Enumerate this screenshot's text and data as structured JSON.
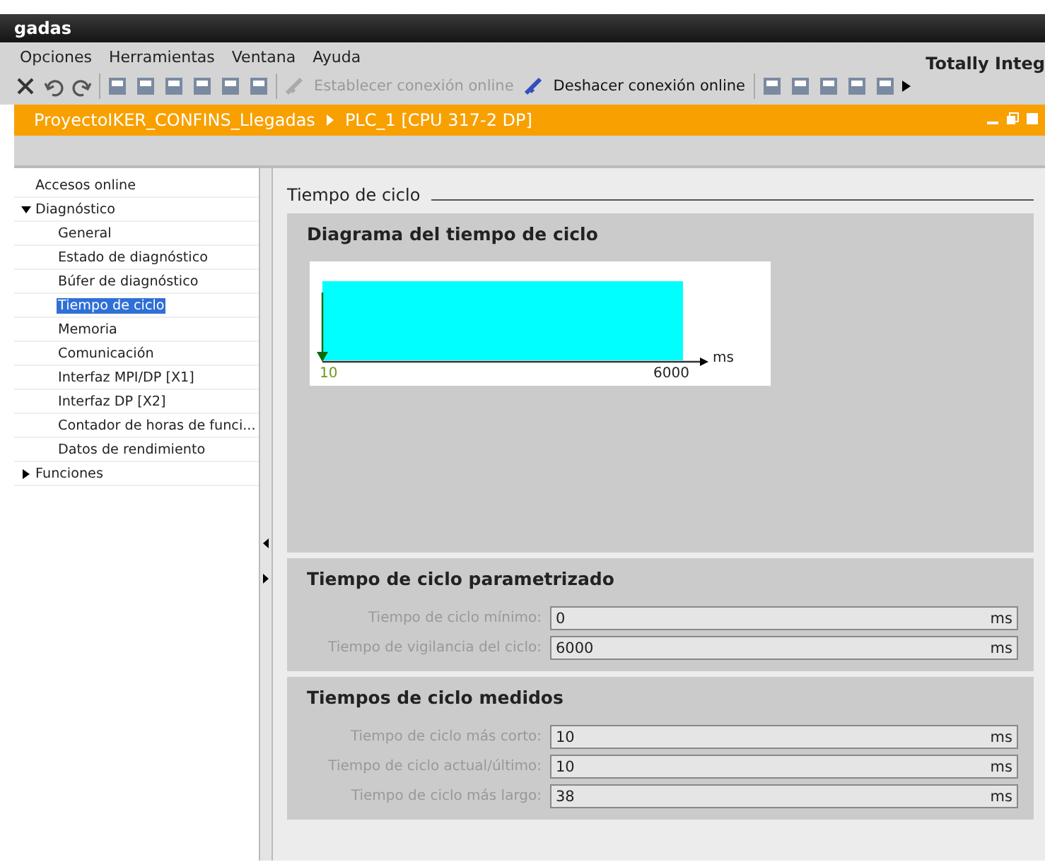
{
  "window": {
    "title": "gadas",
    "product": "Totally Integ"
  },
  "menu": [
    "Opciones",
    "Herramientas",
    "Ventana",
    "Ayuda"
  ],
  "toolbar": [
    {
      "kind": "close"
    },
    {
      "kind": "undo"
    },
    {
      "kind": "redo"
    },
    {
      "kind": "tool"
    },
    {
      "kind": "tool"
    },
    {
      "kind": "tool"
    },
    {
      "kind": "tool"
    },
    {
      "kind": "tool"
    },
    {
      "kind": "tool"
    },
    {
      "kind": "text",
      "label": "Establecer conexión online",
      "disabled": true
    },
    {
      "kind": "text",
      "label": "Deshacer conexión online",
      "disabled": false
    },
    {
      "kind": "tool"
    },
    {
      "kind": "tool"
    },
    {
      "kind": "tool"
    },
    {
      "kind": "tool"
    },
    {
      "kind": "tool"
    },
    {
      "kind": "more"
    }
  ],
  "breadcrumb": [
    "ProyectoIKER_CONFINS_Llegadas",
    "PLC_1 [CPU 317-2 DP]"
  ],
  "sidebar": {
    "items": [
      {
        "label": "Accesos online",
        "selected": false
      },
      {
        "label": "Diagnóstico",
        "selected": false,
        "expanded": true,
        "children": [
          {
            "label": "General",
            "selected": false
          },
          {
            "label": "Estado de diagnóstico",
            "selected": false
          },
          {
            "label": "Búfer de diagnóstico",
            "selected": false
          },
          {
            "label": "Tiempo de ciclo",
            "selected": true
          },
          {
            "label": "Memoria",
            "selected": false
          },
          {
            "label": "Comunicación",
            "selected": false
          },
          {
            "label": "Interfaz MPI/DP [X1]",
            "selected": false
          },
          {
            "label": "Interfaz DP [X2]",
            "selected": false
          },
          {
            "label": "Contador de horas de funci...",
            "selected": false
          },
          {
            "label": "Datos de rendimiento",
            "selected": false
          }
        ]
      },
      {
        "label": "Funciones",
        "selected": false,
        "expanded": false
      }
    ]
  },
  "content": {
    "title": "Tiempo de ciclo",
    "diagram": {
      "title": "Diagrama del tiempo de ciclo",
      "current_label": "10",
      "max_label": "6000",
      "unit": "ms"
    },
    "sections": [
      {
        "title": "Tiempo de ciclo parametrizado",
        "fields": [
          {
            "label": "Tiempo de ciclo mínimo:",
            "value": "0",
            "unit": "ms"
          },
          {
            "label": "Tiempo de vigilancia del ciclo:",
            "value": "6000",
            "unit": "ms"
          }
        ]
      },
      {
        "title": "Tiempos de ciclo medidos",
        "fields": [
          {
            "label": "Tiempo de ciclo más corto:",
            "value": "10",
            "unit": "ms"
          },
          {
            "label": "Tiempo de ciclo actual/último:",
            "value": "10",
            "unit": "ms"
          },
          {
            "label": "Tiempo de ciclo más largo:",
            "value": "38",
            "unit": "ms"
          }
        ]
      }
    ]
  }
}
